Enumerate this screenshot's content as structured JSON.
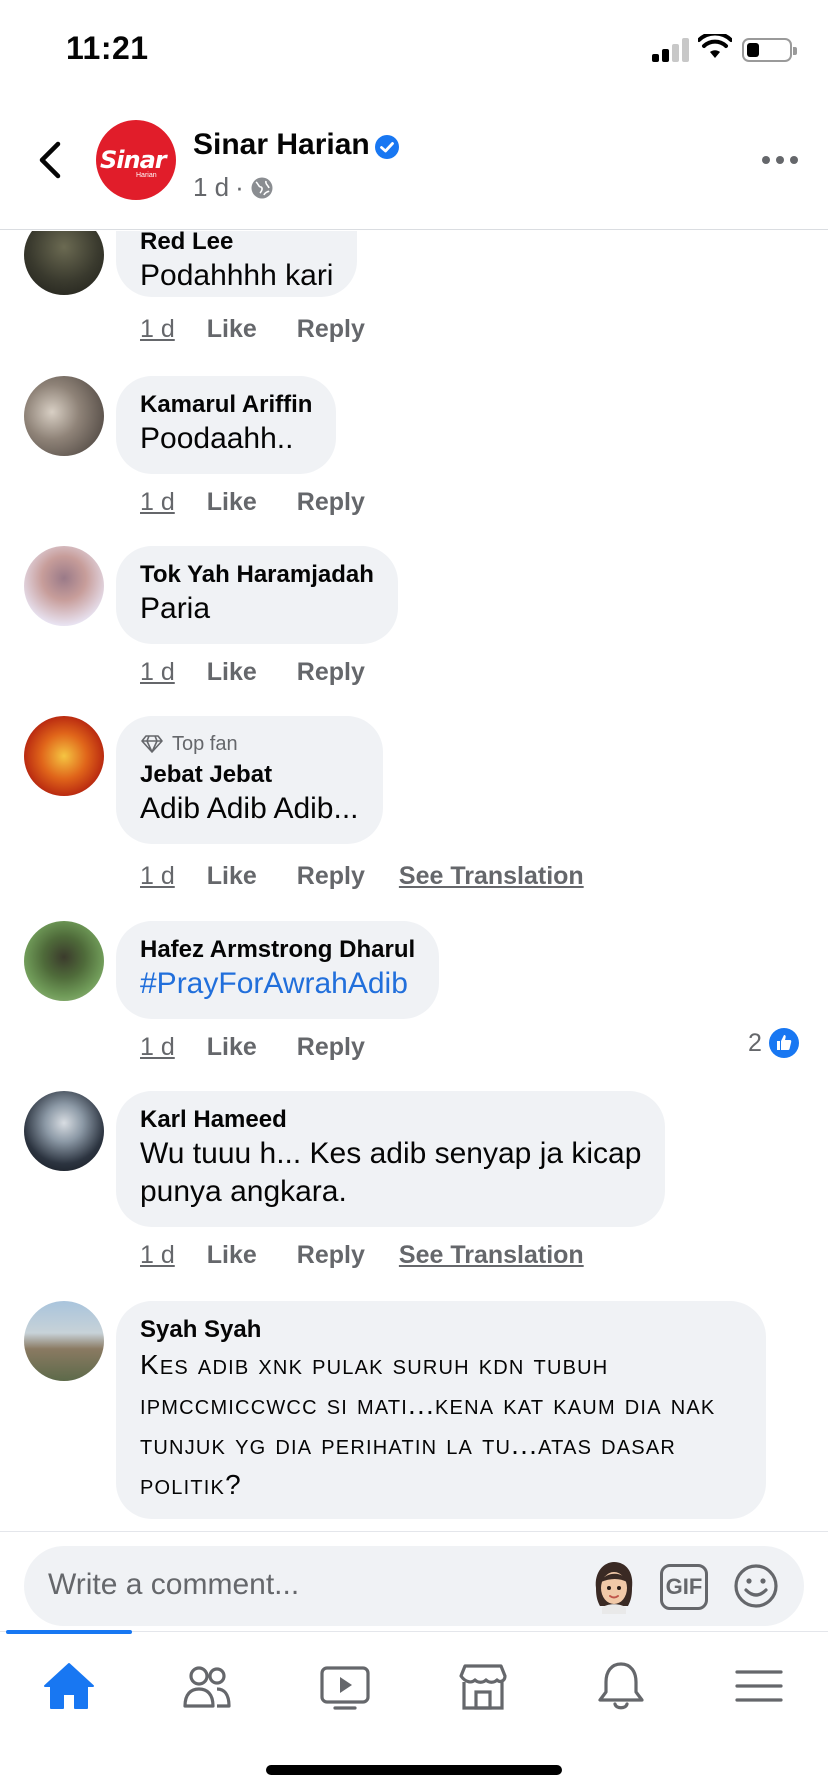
{
  "status_bar": {
    "time": "11:21"
  },
  "header": {
    "page_name": "Sinar Harian",
    "logo_text": "Sinar",
    "logo_sub": "Harian",
    "time": "1 d",
    "separator": "·"
  },
  "comments": [
    {
      "author": "Red Lee",
      "text": "Podahhhh kari",
      "time": "1 d",
      "like": "Like",
      "reply": "Reply"
    },
    {
      "author": "Kamarul Ariffin",
      "text": "Poodaahh..",
      "time": "1 d",
      "like": "Like",
      "reply": "Reply"
    },
    {
      "author": "Tok Yah Haramjadah",
      "text": "Paria",
      "time": "1 d",
      "like": "Like",
      "reply": "Reply"
    },
    {
      "badge": "Top fan",
      "author": "Jebat Jebat",
      "text": "Adib Adib Adib...",
      "time": "1 d",
      "like": "Like",
      "reply": "Reply",
      "see_translation": "See Translation"
    },
    {
      "author": "Hafez Armstrong Dharul",
      "text": "#PrayForAwrahAdib",
      "time": "1 d",
      "like": "Like",
      "reply": "Reply",
      "reaction_count": "2"
    },
    {
      "author": "Karl Hameed",
      "text_line1": "Wu tuuu h...  Kes adib senyap ja kicap",
      "text_line2": "punya angkara.",
      "time": "1 d",
      "like": "Like",
      "reply": "Reply",
      "see_translation": "See Translation"
    },
    {
      "author": "Syah Syah",
      "text": "Kes adib xnk pulak suruh kdn tubuh ipmccmiccwcc si mati...kena kat kaum dia nak tunjuk yg dia perihatin la tu...atas dasar politik?"
    }
  ],
  "composer": {
    "placeholder": "Write a comment...",
    "gif_label": "GIF"
  },
  "tabbar": {
    "icons": [
      "home-icon",
      "friends-icon",
      "watch-icon",
      "marketplace-icon",
      "notifications-icon",
      "menu-icon"
    ]
  },
  "colors": {
    "accent": "#1877f2",
    "link": "#216fdb",
    "bubble": "#f0f2f5",
    "secondary_text": "#65676b",
    "brand_red": "#e11d2a"
  }
}
